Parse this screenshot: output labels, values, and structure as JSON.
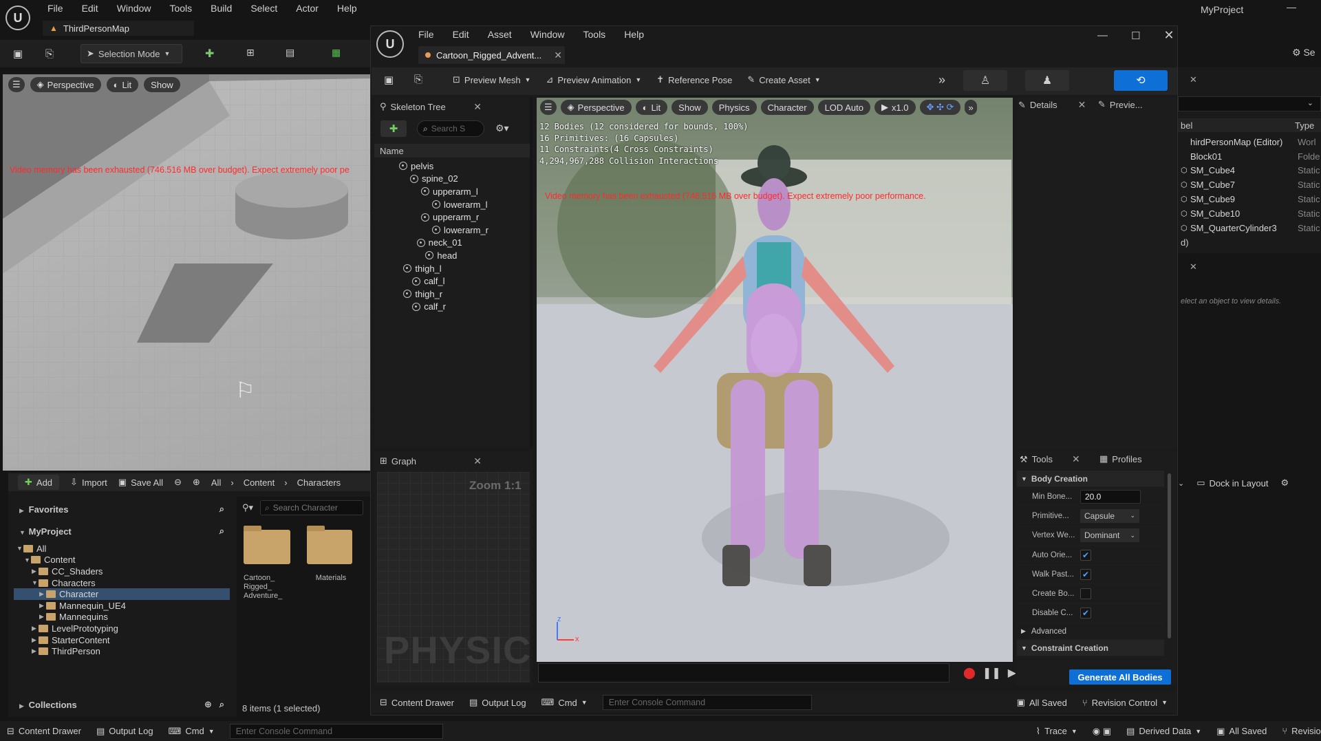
{
  "main_menu": [
    "File",
    "Edit",
    "Window",
    "Tools",
    "Build",
    "Select",
    "Actor",
    "Help"
  ],
  "project_name": "MyProject",
  "level_tab": "ThirdPersonMap",
  "selection_mode": "Selection Mode",
  "level_viewport": {
    "perspective": "Perspective",
    "lit": "Lit",
    "show": "Show",
    "warning": "Video memory has been exhausted (746.516 MB over budget). Expect extremely poor pe"
  },
  "content_browser": {
    "add": "Add",
    "import": "Import",
    "save_all": "Save All",
    "path": [
      "All",
      "Content",
      "Characters"
    ],
    "favorites": "Favorites",
    "project": "MyProject",
    "search_placeholder": "Search Character",
    "tree": [
      {
        "label": "All",
        "depth": 0,
        "open": true,
        "selected": false
      },
      {
        "label": "Content",
        "depth": 1,
        "open": true,
        "selected": false
      },
      {
        "label": "CC_Shaders",
        "depth": 2,
        "open": false,
        "selected": false
      },
      {
        "label": "Characters",
        "depth": 2,
        "open": true,
        "selected": false
      },
      {
        "label": "Character",
        "depth": 3,
        "open": false,
        "selected": true
      },
      {
        "label": "Mannequin_UE4",
        "depth": 3,
        "open": false,
        "selected": false
      },
      {
        "label": "Mannequins",
        "depth": 3,
        "open": false,
        "selected": false
      },
      {
        "label": "LevelPrototyping",
        "depth": 2,
        "open": false,
        "selected": false
      },
      {
        "label": "StarterContent",
        "depth": 2,
        "open": false,
        "selected": false
      },
      {
        "label": "ThirdPerson",
        "depth": 2,
        "open": false,
        "selected": false
      }
    ],
    "assets": [
      "Cartoon_\nRigged_\nAdventure_",
      "Materials"
    ],
    "collections": "Collections",
    "count": "8 items (1 selected)"
  },
  "bottom_bar": {
    "content_drawer": "Content Drawer",
    "output_log": "Output Log",
    "cmd": "Cmd",
    "console_placeholder": "Enter Console Command",
    "trace": "Trace",
    "derived_data": "Derived Data",
    "all_saved": "All Saved",
    "revision": "Revision C"
  },
  "outliner": {
    "col_label": "bel",
    "col_type": "Type",
    "rows": [
      {
        "label": "hirdPersonMap (Editor)",
        "type": "Worl"
      },
      {
        "label": "Block01",
        "type": "Folde"
      },
      {
        "label": "SM_Cube4",
        "type": "Static"
      },
      {
        "label": "SM_Cube7",
        "type": "Static"
      },
      {
        "label": "SM_Cube9",
        "type": "Static"
      },
      {
        "label": "SM_Cube10",
        "type": "Static"
      },
      {
        "label": "SM_QuarterCylinder3",
        "type": "Static"
      }
    ],
    "footer": "d)",
    "details_hint": "elect an object to view details.",
    "dock_in_layout": "Dock in Layout",
    "settings": "Se"
  },
  "asset_editor": {
    "menu": [
      "File",
      "Edit",
      "Asset",
      "Window",
      "Tools",
      "Help"
    ],
    "tab": "Cartoon_Rigged_Advent...",
    "toolbar": {
      "preview_mesh": "Preview Mesh",
      "preview_animation": "Preview Animation",
      "reference_pose": "Reference Pose",
      "create_asset": "Create Asset"
    },
    "skeleton_tree": {
      "title": "Skeleton Tree",
      "search_placeholder": "Search S",
      "column": "Name",
      "bones": [
        {
          "label": "pelvis",
          "depth": 0
        },
        {
          "label": "spine_02",
          "depth": 1
        },
        {
          "label": "upperarm_l",
          "depth": 2
        },
        {
          "label": "lowerarm_l",
          "depth": 3
        },
        {
          "label": "upperarm_r",
          "depth": 2
        },
        {
          "label": "lowerarm_r",
          "depth": 3
        },
        {
          "label": "neck_01",
          "depth": 1.6
        },
        {
          "label": "head",
          "depth": 2.4
        },
        {
          "label": "thigh_l",
          "depth": 0.4
        },
        {
          "label": "calf_l",
          "depth": 1.2
        },
        {
          "label": "thigh_r",
          "depth": 0.4
        },
        {
          "label": "calf_r",
          "depth": 1.2
        }
      ]
    },
    "graph": {
      "title": "Graph",
      "zoom": "Zoom 1:1",
      "watermark": "PHYSIC"
    },
    "viewport": {
      "perspective": "Perspective",
      "lit": "Lit",
      "show": "Show",
      "physics": "Physics",
      "character": "Character",
      "lod": "LOD Auto",
      "speed": "x1.0",
      "stats": [
        "12 Bodies (12 considered for bounds, 100%)",
        "16 Primitives: (16 Capsules)",
        "11 Constraints(4 Cross Constraints)",
        "4,294,967,288 Collision Interactions"
      ],
      "warning": "Video memory has been exhausted (746.516 MB over budget). Expect extremely poor performance."
    },
    "details": {
      "title": "Details",
      "preview_tab": "Previe..."
    },
    "tools": {
      "title": "Tools",
      "profiles": "Profiles",
      "section_body": "Body Creation",
      "min_bone_label": "Min Bone...",
      "min_bone_value": "20.0",
      "primitive_label": "Primitive...",
      "primitive_value": "Capsule",
      "vertex_label": "Vertex We...",
      "vertex_value": "Dominant",
      "auto_orient_label": "Auto Orie...",
      "walk_past_label": "Walk Past...",
      "create_body_label": "Create Bo...",
      "disable_c_label": "Disable C...",
      "advanced": "Advanced",
      "section_constraint": "Constraint Creation",
      "generate": "Generate All Bodies"
    },
    "bottom": {
      "content_drawer": "Content Drawer",
      "output_log": "Output Log",
      "cmd": "Cmd",
      "console_placeholder": "Enter Console Command",
      "all_saved": "All Saved",
      "revision": "Revision Control"
    }
  },
  "colors": {
    "accent": "#0e6fd6",
    "warning": "#ff3b3b",
    "folder": "#c8a46a"
  }
}
